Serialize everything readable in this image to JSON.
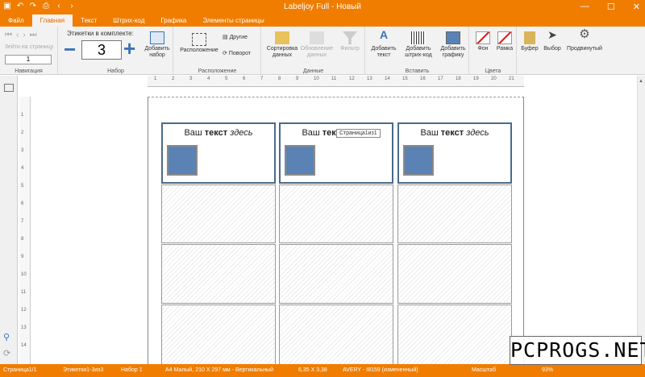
{
  "window": {
    "title": "Labeljoy Full - Новый"
  },
  "tabs": [
    "Файл",
    "Главная",
    "Текст",
    "Штрих-код",
    "Графика",
    "Элементы страницы"
  ],
  "ribbon": {
    "nav": {
      "goto": "Зейти на страницу",
      "page_value": "1",
      "label": "Навигация"
    },
    "set": {
      "caption": "Этикетки в комплекте:",
      "count": "3",
      "add": "Добавить набор",
      "label": "Набор"
    },
    "arrange": {
      "layout": "Расположение",
      "other": "Другие",
      "rotate": "Поворот",
      "label": "Расположение"
    },
    "data": {
      "sort": "Сортировка данных",
      "refresh": "Обновление данных",
      "filter": "Фильтр",
      "label": "Данные"
    },
    "insert": {
      "text": "Добавить текст",
      "barcode": "Добавить штрих-код",
      "graphic": "Добавить графику",
      "label": "Вставить"
    },
    "colors": {
      "bg": "Фон",
      "frame": "Рамка",
      "label": "Цвета"
    },
    "misc": {
      "buffer": "Буфер",
      "select": "Выбор",
      "advanced": "Продвинутый"
    }
  },
  "ruler_h": [
    "1",
    "2",
    "3",
    "4",
    "5",
    "6",
    "7",
    "8",
    "9",
    "10",
    "11",
    "12",
    "13",
    "14",
    "15",
    "16",
    "17",
    "18",
    "19",
    "20",
    "21"
  ],
  "ruler_v": [
    "1",
    "2",
    "3",
    "4",
    "5",
    "6",
    "7",
    "8",
    "9",
    "10",
    "11",
    "12",
    "13",
    "14"
  ],
  "labels": {
    "text_a": "Ваш ",
    "text_b": "текст",
    "text_c": " здесь"
  },
  "tooltip": "Страница1из1",
  "status": {
    "page": "Страница1/1",
    "labels": "Этикетки1-3из3",
    "set": "Набор 1",
    "paper": "А4 Малый, 210 X 297 мм - Вертикальный",
    "dims": "6,35 X 3,38",
    "template": "AVERY - I8159 (измененный)",
    "scale": "Масштаб",
    "zoom": "93%"
  },
  "watermark": "PCPROGS.NET",
  "colors": {
    "accent": "#f07d00",
    "frame": "#4a6b8a"
  }
}
